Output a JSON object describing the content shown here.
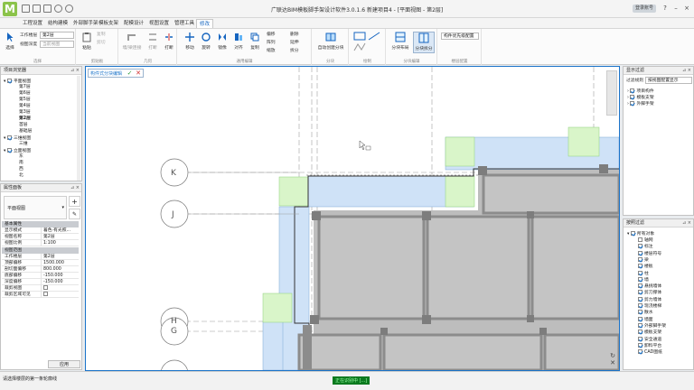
{
  "app": {
    "title": "广联达BIM模板脚手架设计软件3.0.1.6 新建项目4 - [平面视图 - 第2层]",
    "user": "登录账号",
    "logo_letter": "M"
  },
  "menu": {
    "tabs": [
      "工程设置",
      "结构建模",
      "外部脚手架",
      "模板支架",
      "配模设计",
      "视图设置",
      "管理工具",
      "修改"
    ],
    "active_index": 7
  },
  "ribbon": {
    "select_label": "选择",
    "floor_label": "工作楼层",
    "floor_value": "第2层",
    "view_range_label": "视图深度",
    "view_range_value": "当前视图",
    "paste_label": "粘贴",
    "copy_label": "复制",
    "cut_label": "剪切",
    "wall_label": "墙/梁连接",
    "trim_label": "打断",
    "break_label": "打断",
    "move_label": "移动",
    "rotate_label": "旋转",
    "mirror_label": "镜像",
    "align_label": "对齐",
    "copy2_label": "复制",
    "offset_label": "偏移",
    "array_label": "阵列",
    "scale_label": "缩放",
    "delete_label": "删除",
    "extend_label": "延伸",
    "split_label": "拆分",
    "auto_create_label": "自动创建分块",
    "draw_label": "绘制",
    "block_layout_label": "分块布局",
    "block_edit_label": "分块拆分",
    "group_select": "选择",
    "group_clipboard": "剪贴板",
    "group_geometry": "几何",
    "group_modify": "通用编辑",
    "group_block": "分块",
    "group_draw": "绘制",
    "group_blockedit": "分块编辑",
    "group_floor_attr": "楼层配置",
    "floor_attr_value": "构件优先级配置"
  },
  "project_browser": {
    "title": "项目浏览器",
    "items": [
      "平面视图",
      "第7层",
      "第6层",
      "第5层",
      "第4层",
      "第3层",
      "第2层",
      "首层",
      "基础层",
      "三维视图",
      "三维",
      "立面视图",
      "东",
      "南",
      "西",
      "北"
    ]
  },
  "properties": {
    "title": "属性面板",
    "type_value": "平面视图",
    "sections": [
      "基本属性",
      "视图范围"
    ],
    "rows": [
      {
        "k": "显示模式",
        "v": "着色·有光照..."
      },
      {
        "k": "视图名称",
        "v": "第2层"
      },
      {
        "k": "视图比例",
        "v": "1:100"
      },
      {
        "k": "工作楼层",
        "v": "第2层"
      },
      {
        "k": "顶部偏移",
        "v": "1500.000"
      },
      {
        "k": "剖切面偏移",
        "v": "800.000"
      },
      {
        "k": "底部偏移",
        "v": "-150.000"
      },
      {
        "k": "深度偏移",
        "v": "-150.000"
      },
      {
        "k": "裁剪视图",
        "v": ""
      },
      {
        "k": "裁剪区域可见",
        "v": ""
      }
    ],
    "apply_label": "应用"
  },
  "canvas": {
    "edit_bar_label": "构件式分块编辑",
    "axis_labels": [
      "K",
      "J",
      "H",
      "G"
    ]
  },
  "display_filter": {
    "title": "显示过滤",
    "filter_label": "过滤规则",
    "filter_value": "按视图配置显示",
    "items": [
      "项目构件",
      "模板支架",
      "外脚手架"
    ]
  },
  "selection_filter": {
    "title": "按照过滤",
    "root": "所有对象",
    "items": [
      "轴网",
      "标注",
      "楼层符号",
      "梁",
      "楼板",
      "柱",
      "墙",
      "悬挑墙体",
      "剪刀撑体",
      "剪力墙体",
      "现浇楼梯",
      "散水",
      "墙面",
      "外部脚手架",
      "模板支架",
      "安全通道",
      "卸料平台",
      "CAD图纸"
    ]
  },
  "status": {
    "text": "请选择楼层的第一条轮廓线",
    "badge": "正在识别中 [...]"
  },
  "colors": {
    "accent": "#1a73c9",
    "block_blue": "#cfe2f7",
    "block_green": "#d9f5c9",
    "wall_gray": "#8c8c8c",
    "slab_gray": "#bcbcbc"
  }
}
